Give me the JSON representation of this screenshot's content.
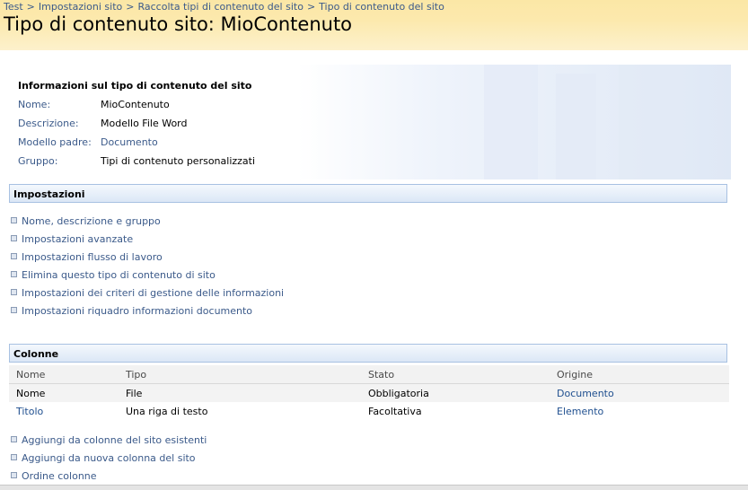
{
  "breadcrumb": {
    "items": [
      "Test",
      "Impostazioni sito",
      "Raccolta tipi di contenuto del sito"
    ],
    "separator": ">",
    "current": "Tipo di contenuto del sito"
  },
  "page_title": "Tipo di contenuto sito: MioContenuto",
  "info": {
    "heading": "Informazioni sul tipo di contenuto del sito",
    "rows": [
      {
        "label": "Nome:",
        "value": "MioContenuto"
      },
      {
        "label": "Descrizione:",
        "value": "Modello File Word"
      },
      {
        "label": "Modello padre:",
        "value": "Documento"
      },
      {
        "label": "Gruppo:",
        "value": "Tipi di contenuto personalizzati"
      }
    ]
  },
  "settings": {
    "title": "Impostazioni",
    "links": [
      "Nome, descrizione e gruppo",
      "Impostazioni avanzate",
      "Impostazioni flusso di lavoro",
      "Elimina questo tipo di contenuto di sito",
      "Impostazioni dei criteri di gestione delle informazioni",
      "Impostazioni riquadro informazioni documento"
    ]
  },
  "columns": {
    "title": "Colonne",
    "headers": [
      "Nome",
      "Tipo",
      "Stato",
      "Origine"
    ],
    "rows": [
      [
        "Nome",
        "File",
        "Obbligatoria",
        "Documento"
      ],
      [
        "Titolo",
        "Una riga di testo",
        "Facoltativa",
        "Elemento"
      ]
    ],
    "links": [
      "Aggiungi da colonne del sito esistenti",
      "Aggiungi da nuova colonna del sito",
      "Ordine colonne"
    ]
  }
}
